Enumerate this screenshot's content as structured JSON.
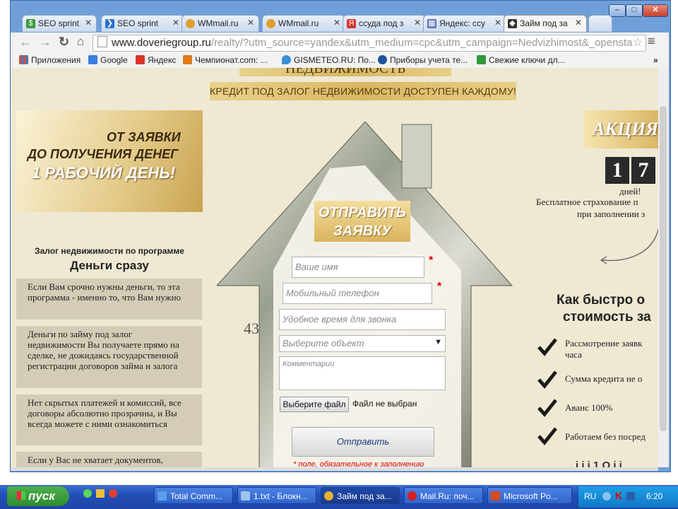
{
  "browser": {
    "tabs": [
      {
        "label": "SEO sprint",
        "icon": "dollar-icon",
        "color": "#3a9a3a"
      },
      {
        "label": "SEO sprint",
        "icon": "arrow-icon",
        "color": "#2a6fc9"
      },
      {
        "label": "WMmail.ru",
        "icon": "coin-icon",
        "color": "#e0a030"
      },
      {
        "label": "WMmail.ru",
        "icon": "coin-icon",
        "color": "#e0a030"
      },
      {
        "label": "ссуда под з",
        "icon": "yandex-icon",
        "color": "#d9352b"
      },
      {
        "label": "Яндекс: ссу",
        "icon": "chart-icon",
        "color": "#5b6fb5"
      },
      {
        "label": "Займ под за",
        "icon": "site-icon",
        "color": "#333333"
      }
    ],
    "url_host": "www.doveriegroup.ru",
    "url_path": "/realty/?utm_source=yandex&utm_medium=cpc&utm_campaign=Nedvizhimost&_opensta",
    "bookmarks": [
      {
        "label": "Приложения",
        "color": "#e04b2a"
      },
      {
        "label": "Google",
        "color": "#3b7ce0"
      },
      {
        "label": "Яндекс",
        "color": "#d9352b"
      },
      {
        "label": "Чемпионат.com: ...",
        "color": "#e07a1a"
      },
      {
        "label": "GISMETEO.RU: По...",
        "color": "#3a8fd6"
      },
      {
        "label": "Приборы учета те...",
        "color": "#20509a"
      },
      {
        "label": "Свежие ключи дл...",
        "color": "#2e9a3a"
      }
    ]
  },
  "page": {
    "header_partial": "НЕДВИЖИМОСТЬ",
    "header_banner": "КРЕДИТ ПОД ЗАЛОГ НЕДВИЖИМОСТИ ДОСТУПЕН КАЖДОМУ!",
    "promo_line1": "ОТ ЗАЯВКИ",
    "promo_line2": "ДО ПОЛУЧЕНИЯ ДЕНЕГ",
    "promo_line3": "1 РАБОЧИЙ ДЕНЬ!",
    "program_caption": "Залог недвижимости по программе",
    "program_name": "Деньги сразу",
    "left_points": [
      "Если Вам срочно нужны деньги, то эта программа - именно то, что Вам нужно",
      "Деньги по займу под залог недвижимости Вы получаете прямо на сделке, не дожидаясь государственной регистрации договоров займа и залога",
      "Нет скрытых платежей и комиссий, все договоры абсолютно прозрачны, и Вы всегда можете с ними ознакомиться",
      "Если у Вас не хватает документов,"
    ],
    "form_title_1": "ОТПРАВИТЬ",
    "form_title_2": "ЗАЯВКУ",
    "form": {
      "name_placeholder": "Ваше имя",
      "phone_placeholder": "Мобильный телефон",
      "time_placeholder": "Удобное время для звонка",
      "select_value": "Выберите объект",
      "comment_placeholder": "Комментарии",
      "file_button": "Выберите файл",
      "file_status": "Файл не выбран",
      "submit": "Отправить",
      "required_note": "* поле, обязательное к заполнению",
      "required_mark": "*"
    },
    "promo_title": "АКЦИЯ!",
    "counter_digits": [
      "1",
      "7"
    ],
    "counter_unit": "дней!",
    "promo_text_1": "Бесплатное страхование п",
    "promo_text_2": "при заполнении з",
    "how_title_1": "Как быстро о",
    "how_title_2": "стоимость за",
    "features": [
      {
        "l1": "Рассмотрение заявк",
        "l2": "часа"
      },
      {
        "l1": "Сумма кредита не о",
        "l2": ""
      },
      {
        "l1": "Аванс 100%",
        "l2": ""
      },
      {
        "l1": "Работаем без посред",
        "l2": ""
      }
    ],
    "bottom_partial": "i i i 1 O i i"
  },
  "taskbar": {
    "start": "пуск",
    "tasks": [
      {
        "label": "Total Comm...",
        "color": "#5aa0e8"
      },
      {
        "label": "1.txt - Блокн...",
        "color": "#9ec3ee"
      },
      {
        "label": "Займ под за...",
        "color": "#e8b030"
      },
      {
        "label": "Mail.Ru: поч...",
        "color": "#d82020"
      },
      {
        "label": "Microsoft Po...",
        "color": "#d84a1a"
      }
    ],
    "lang": "RU",
    "clock": "6:20"
  }
}
